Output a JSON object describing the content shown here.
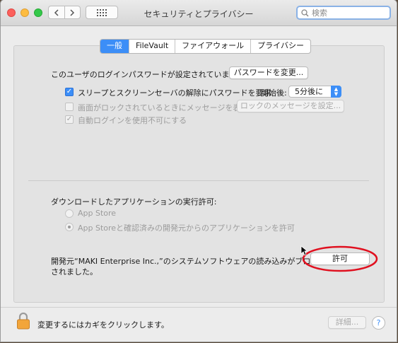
{
  "window": {
    "title": "セキュリティとプライバシー"
  },
  "toolbar": {
    "back_icon": "chevron-left-icon",
    "forward_icon": "chevron-right-icon",
    "grid_icon": "grid-icon",
    "search_placeholder": "検索"
  },
  "tabs": [
    {
      "label": "一般",
      "active": true
    },
    {
      "label": "FileVault",
      "active": false
    },
    {
      "label": "ファイアウォール",
      "active": false
    },
    {
      "label": "プライバシー",
      "active": false
    }
  ],
  "general": {
    "password_set_text": "このユーザのログインパスワードが設定されています",
    "change_password_button": "パスワードを変更...",
    "require_password_label": "スリープとスクリーンセーバの解除にパスワードを要求",
    "start_after_label": "開始後:",
    "start_after_value": "5分後に",
    "lock_message_label": "画面がロックされているときにメッセージを表示",
    "lock_message_button": "ロックのメッセージを設定...",
    "disable_autologin_label": "自動ログインを使用不可にする"
  },
  "downloads": {
    "heading": "ダウンロードしたアプリケーションの実行許可:",
    "option_app_store": "App Store",
    "option_app_store_identified": "App Storeと確認済みの開発元からのアプリケーションを許可"
  },
  "blocked": {
    "message_line1": "開発元“MAKI Enterprise Inc.,”のシステムソフトウェアの読み込みがブロック",
    "message_line2": "されました。",
    "allow_button": "許可"
  },
  "footer": {
    "lock_text": "変更するにはカギをクリックします。",
    "advanced_button": "詳細...",
    "help_label": "?"
  },
  "colors": {
    "accent": "#3c8ef7",
    "annotation_ellipse": "#e0101f"
  }
}
